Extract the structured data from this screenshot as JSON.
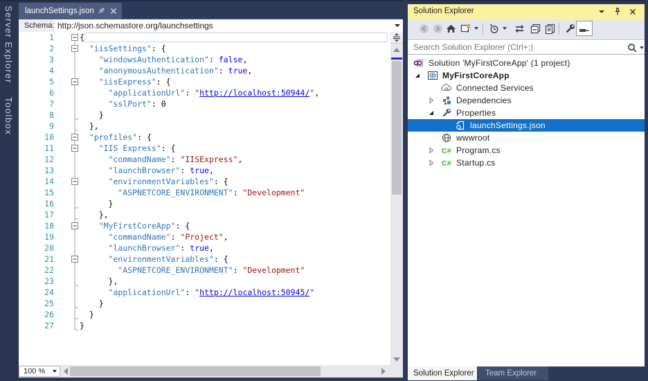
{
  "left_bar": {
    "tabs": [
      {
        "label": "Server Explorer"
      },
      {
        "label": "Toolbox"
      }
    ]
  },
  "editor": {
    "tab": {
      "title": "launchSettings.json",
      "pin_icon": "pin-icon",
      "close_icon": "close-icon"
    },
    "schema_bar": {
      "label": "Schema:",
      "value": "http://json.schemastore.org/launchsettings"
    },
    "zoom_level": "100 %",
    "code": {
      "fold_open_lines": [
        1,
        2,
        5,
        10,
        11,
        14,
        18,
        21
      ],
      "fold_end_lines": [
        8,
        9,
        16,
        17,
        23,
        25,
        26,
        27
      ],
      "caret_line": 1,
      "lines": [
        {
          "n": 1,
          "segs": [
            [
              "p",
              "{"
            ]
          ]
        },
        {
          "n": 2,
          "segs": [
            [
              "p",
              "  "
            ],
            [
              "k",
              "\"iisSettings\""
            ],
            [
              "p",
              ": {"
            ]
          ]
        },
        {
          "n": 3,
          "segs": [
            [
              "p",
              "    "
            ],
            [
              "k",
              "\"windowsAuthentication\""
            ],
            [
              "p",
              ": "
            ],
            [
              "b",
              "false"
            ],
            [
              "p",
              ","
            ]
          ]
        },
        {
          "n": 4,
          "segs": [
            [
              "p",
              "    "
            ],
            [
              "k",
              "\"anonymousAuthentication\""
            ],
            [
              "p",
              ": "
            ],
            [
              "b",
              "true"
            ],
            [
              "p",
              ","
            ]
          ]
        },
        {
          "n": 5,
          "segs": [
            [
              "p",
              "    "
            ],
            [
              "k",
              "\"iisExpress\""
            ],
            [
              "p",
              ": {"
            ]
          ]
        },
        {
          "n": 6,
          "segs": [
            [
              "p",
              "      "
            ],
            [
              "k",
              "\"applicationUrl\""
            ],
            [
              "p",
              ": "
            ],
            [
              "s",
              "\""
            ],
            [
              "u",
              "http://localhost:50944/"
            ],
            [
              "s",
              "\""
            ],
            [
              "p",
              ","
            ]
          ]
        },
        {
          "n": 7,
          "segs": [
            [
              "p",
              "      "
            ],
            [
              "k",
              "\"sslPort\""
            ],
            [
              "p",
              ": "
            ],
            [
              "n",
              "0"
            ]
          ]
        },
        {
          "n": 8,
          "segs": [
            [
              "p",
              "    }"
            ]
          ]
        },
        {
          "n": 9,
          "segs": [
            [
              "p",
              "  },"
            ]
          ]
        },
        {
          "n": 10,
          "segs": [
            [
              "p",
              "  "
            ],
            [
              "k",
              "\"profiles\""
            ],
            [
              "p",
              ": {"
            ]
          ]
        },
        {
          "n": 11,
          "segs": [
            [
              "p",
              "    "
            ],
            [
              "k",
              "\"IIS Express\""
            ],
            [
              "p",
              ": {"
            ]
          ]
        },
        {
          "n": 12,
          "segs": [
            [
              "p",
              "      "
            ],
            [
              "k",
              "\"commandName\""
            ],
            [
              "p",
              ": "
            ],
            [
              "s",
              "\"IISExpress\""
            ],
            [
              "p",
              ","
            ]
          ]
        },
        {
          "n": 13,
          "segs": [
            [
              "p",
              "      "
            ],
            [
              "k",
              "\"launchBrowser\""
            ],
            [
              "p",
              ": "
            ],
            [
              "b",
              "true"
            ],
            [
              "p",
              ","
            ]
          ]
        },
        {
          "n": 14,
          "segs": [
            [
              "p",
              "      "
            ],
            [
              "k",
              "\"environmentVariables\""
            ],
            [
              "p",
              ": {"
            ]
          ]
        },
        {
          "n": 15,
          "segs": [
            [
              "p",
              "        "
            ],
            [
              "k",
              "\"ASPNETCORE_ENVIRONMENT\""
            ],
            [
              "p",
              ": "
            ],
            [
              "s",
              "\"Development\""
            ]
          ]
        },
        {
          "n": 16,
          "segs": [
            [
              "p",
              "      }"
            ]
          ]
        },
        {
          "n": 17,
          "segs": [
            [
              "p",
              "    },"
            ]
          ]
        },
        {
          "n": 18,
          "segs": [
            [
              "p",
              "    "
            ],
            [
              "k",
              "\"MyFirstCoreApp\""
            ],
            [
              "p",
              ": {"
            ]
          ]
        },
        {
          "n": 19,
          "segs": [
            [
              "p",
              "      "
            ],
            [
              "k",
              "\"commandName\""
            ],
            [
              "p",
              ": "
            ],
            [
              "s",
              "\"Project\""
            ],
            [
              "p",
              ","
            ]
          ]
        },
        {
          "n": 20,
          "segs": [
            [
              "p",
              "      "
            ],
            [
              "k",
              "\"launchBrowser\""
            ],
            [
              "p",
              ": "
            ],
            [
              "b",
              "true"
            ],
            [
              "p",
              ","
            ]
          ]
        },
        {
          "n": 21,
          "segs": [
            [
              "p",
              "      "
            ],
            [
              "k",
              "\"environmentVariables\""
            ],
            [
              "p",
              ": {"
            ]
          ]
        },
        {
          "n": 22,
          "segs": [
            [
              "p",
              "        "
            ],
            [
              "k",
              "\"ASPNETCORE_ENVIRONMENT\""
            ],
            [
              "p",
              ": "
            ],
            [
              "s",
              "\"Development\""
            ]
          ]
        },
        {
          "n": 23,
          "segs": [
            [
              "p",
              "      },"
            ]
          ]
        },
        {
          "n": 24,
          "segs": [
            [
              "p",
              "      "
            ],
            [
              "k",
              "\"applicationUrl\""
            ],
            [
              "p",
              ": "
            ],
            [
              "s",
              "\""
            ],
            [
              "u",
              "http://localhost:50945/"
            ],
            [
              "s",
              "\""
            ]
          ]
        },
        {
          "n": 25,
          "segs": [
            [
              "p",
              "    }"
            ]
          ]
        },
        {
          "n": 26,
          "segs": [
            [
              "p",
              "  }"
            ]
          ]
        },
        {
          "n": 27,
          "segs": [
            [
              "p",
              "}"
            ]
          ]
        }
      ]
    }
  },
  "solution_explorer": {
    "title": "Solution Explorer",
    "titlebar_icons": [
      "window-position-icon",
      "pin-icon",
      "close-icon"
    ],
    "toolbar_icons": [
      "back-icon",
      "forward-icon",
      "home-icon",
      "switch-views-icon",
      "pending-changes-filter-icon",
      "sync-icon",
      "collapse-all-icon",
      "copy-icon",
      "properties-icon",
      "preview-selected-toggle-icon"
    ],
    "search": {
      "placeholder": "Search Solution Explorer (Ctrl+;)",
      "icon": "search-icon"
    },
    "tree": [
      {
        "label": "Solution 'MyFirstCoreApp' (1 project)",
        "icon": "solution-icon",
        "level": 0,
        "arrow": "none"
      },
      {
        "label": "MyFirstCoreApp",
        "icon": "project-icon",
        "level": 1,
        "arrow": "expanded",
        "bold": true
      },
      {
        "label": "Connected Services",
        "icon": "connected-services-icon",
        "level": 2,
        "arrow": "none"
      },
      {
        "label": "Dependencies",
        "icon": "dependencies-icon",
        "level": 2,
        "arrow": "collapsed"
      },
      {
        "label": "Properties",
        "icon": "properties-icon",
        "level": 2,
        "arrow": "expanded"
      },
      {
        "label": "launchSettings.json",
        "icon": "json-file-icon",
        "level": 3,
        "arrow": "none",
        "selected": true
      },
      {
        "label": "wwwroot",
        "icon": "globe-icon",
        "level": 2,
        "arrow": "none"
      },
      {
        "label": "Program.cs",
        "icon": "csharp-icon",
        "level": 2,
        "arrow": "collapsed"
      },
      {
        "label": "Startup.cs",
        "icon": "csharp-icon",
        "level": 2,
        "arrow": "collapsed"
      }
    ],
    "bottom_tabs": [
      {
        "label": "Solution Explorer",
        "active": true
      },
      {
        "label": "Team Explorer",
        "active": false
      }
    ]
  },
  "colors": {
    "environment_background": "#2C3A57",
    "leftbar_background": "#2B3450",
    "active_tab_background": "#4D5C80",
    "panel_title_background": "#FBF2A0",
    "selected_row_background": "#1170C8",
    "line_number": "#2B91AF",
    "json_key": "#2E75B6",
    "json_string": "#A31515",
    "json_keyword": "#0000FF",
    "url_link": "#0000EE",
    "scrollbar_track": "#E8E8EC",
    "scrollbar_thumb": "#C2C3C9"
  }
}
